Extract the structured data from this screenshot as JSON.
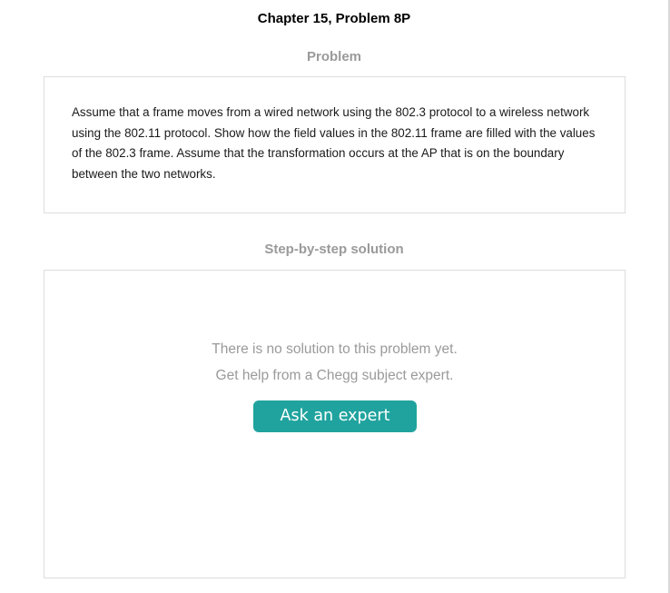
{
  "header": {
    "chapter_title": "Chapter 15, Problem 8P"
  },
  "problem": {
    "heading": "Problem",
    "text": "Assume that a frame moves from a wired network using the 802.3 protocol to a wireless network using the 802.11 protocol. Show how the field values in the 802.11 frame are filled with the values of the 802.3 frame. Assume that the transformation occurs at the AP that is on the boundary between the two networks."
  },
  "solution": {
    "heading": "Step-by-step solution",
    "empty_line_1": "There is no solution to this problem yet.",
    "empty_line_2": "Get help from a Chegg subject expert.",
    "ask_button_label": "Ask an expert"
  },
  "colors": {
    "accent": "#20a39e",
    "muted_text": "#9a9a9a",
    "border": "#dddddd"
  }
}
